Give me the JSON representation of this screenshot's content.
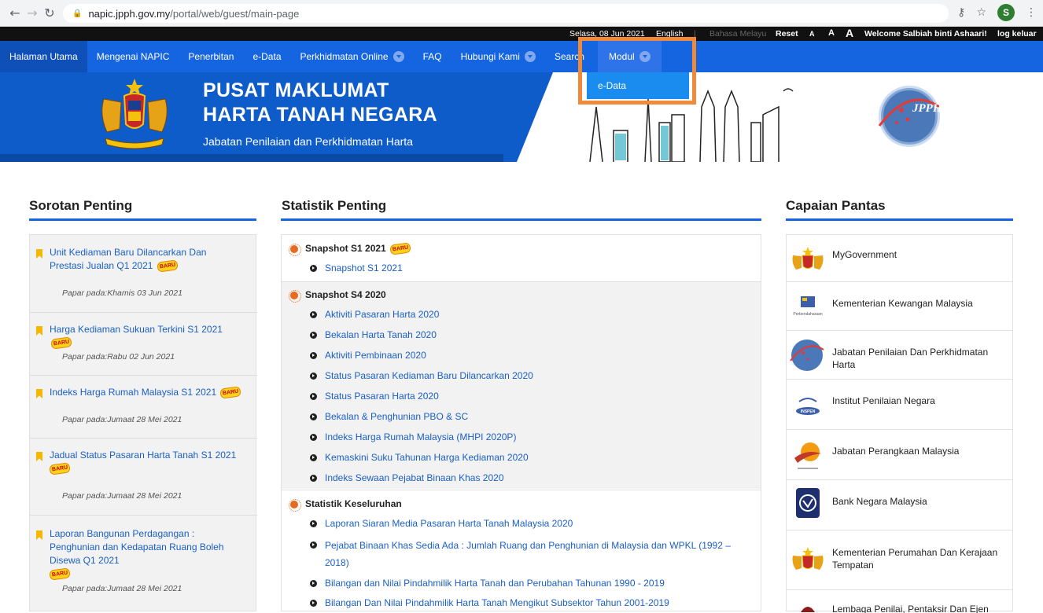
{
  "browser": {
    "url_host": "napic.jpph.gov.my",
    "url_path": "/portal/web/guest/main-page",
    "back_icon": "arrow-left-icon",
    "forward_icon": "arrow-right-icon",
    "reload_icon": "reload-icon",
    "avatar_letter": "S"
  },
  "utilbar": {
    "date": "Selasa, 08 Jun 2021",
    "lang_english": "English",
    "lang_separator": "|",
    "lang_malay": "Bahasa Melayu",
    "reset": "Reset",
    "font_small": "A",
    "font_medium": "A",
    "font_large": "A",
    "welcome": "Welcome Salbiah binti Ashaari!",
    "logout": "log keluar"
  },
  "nav": {
    "items": [
      {
        "label": "Halaman Utama"
      },
      {
        "label": "Mengenai NAPIC"
      },
      {
        "label": "Penerbitan"
      },
      {
        "label": "e-Data"
      },
      {
        "label": "Perkhidmatan Online"
      },
      {
        "label": "FAQ"
      },
      {
        "label": "Hubungi Kami"
      },
      {
        "label": "Search"
      },
      {
        "label": "Modul"
      }
    ],
    "dropdown": {
      "item": "e-Data"
    }
  },
  "banner": {
    "title_line1": "PUSAT MAKLUMAT",
    "title_line2": "HARTA TANAH NEGARA",
    "subtitle": "Jabatan Penilaian dan Perkhidmatan Harta",
    "jpph_logo_text": "JPPH"
  },
  "badge": "BARU",
  "sorotan": {
    "title": "Sorotan Penting",
    "items": [
      {
        "title": "Unit Kediaman Baru Dilancarkan Dan Prestasi Jualan Q1 2021",
        "date": "Papar pada:Khamis 03 Jun 2021"
      },
      {
        "title": "Harga Kediaman Sukuan Terkini S1 2021",
        "date": "Papar pada:Rabu 02 Jun 2021"
      },
      {
        "title": "Indeks Harga Rumah Malaysia S1 2021",
        "date": "Papar pada:Jumaat 28 Mei 2021"
      },
      {
        "title": "Jadual Status Pasaran Harta Tanah S1 2021",
        "date": "Papar pada:Jumaat 28 Mei 2021"
      },
      {
        "title": "Laporan Bangunan Perdagangan : Penghunian dan Kedapatan Ruang Boleh Disewa Q1 2021",
        "date": "Papar pada:Jumaat 28 Mei 2021"
      }
    ]
  },
  "statistik": {
    "title": "Statistik Penting",
    "groups": [
      {
        "head": "Snapshot S1 2021",
        "items": [
          "Snapshot S1 2021"
        ]
      },
      {
        "head": "Snapshot S4 2020",
        "items": [
          "Aktiviti Pasaran Harta 2020",
          "Bekalan Harta Tanah 2020",
          "Aktiviti Pembinaan 2020",
          "Status Pasaran Kediaman Baru Dilancarkan 2020",
          "Status Pasaran Harta 2020",
          "Bekalan & Penghunian PBO & SC",
          "Indeks Harga Rumah Malaysia (MHPI 2020P)",
          "Kemaskini Suku Tahunan Harga Kediaman 2020",
          "Indeks Sewaan Pejabat Binaan Khas 2020"
        ]
      },
      {
        "head": "Statistik Keseluruhan",
        "items": [
          "Laporan Siaran Media Pasaran Harta Tanah Malaysia 2020",
          "Pejabat Binaan Khas Sedia Ada : Jumlah Ruang dan Penghunian di Malaysia dan WPKL (1992 – 2018)",
          "Bilangan dan Nilai Pindahmilik Harta Tanah dan Perubahan Tahunan 1990 - 2019",
          "Bilangan Dan Nilai Pindahmilik Harta Tanah Mengikut Subsektor Tahun 2001-2019"
        ]
      }
    ]
  },
  "capaian": {
    "title": "Capaian Pantas",
    "items": [
      {
        "label": "MyGovernment",
        "icon": "malaysia-crest-icon"
      },
      {
        "label": "Kementerian Kewangan Malaysia",
        "icon": "perbendaharaan-logo-icon",
        "logo_caption": "Perbendaharaan"
      },
      {
        "label": "Jabatan Penilaian Dan Perkhidmatan Harta",
        "icon": "jpph-globe-icon"
      },
      {
        "label": "Institut Penilaian Negara",
        "icon": "inspen-logo-icon",
        "logo_caption": "INSPEN"
      },
      {
        "label": "Jabatan Perangkaan Malaysia",
        "icon": "dosm-logo-icon"
      },
      {
        "label": "Bank Negara Malaysia",
        "icon": "bnm-logo-icon"
      },
      {
        "label": "Kementerian Perumahan Dan Kerajaan Tempatan",
        "icon": "malaysia-crest-icon"
      },
      {
        "label": "Lembaga Penilai, Pentaksir Dan Ejen Harta",
        "icon": "lppeh-logo-icon"
      }
    ]
  },
  "colors": {
    "nav_blue": "#1565e0",
    "banner_blue": "#0d5cc9",
    "link_blue": "#1a5fc5",
    "highlight_orange": "#f08a3a",
    "flag_yellow": "#f4b800"
  }
}
